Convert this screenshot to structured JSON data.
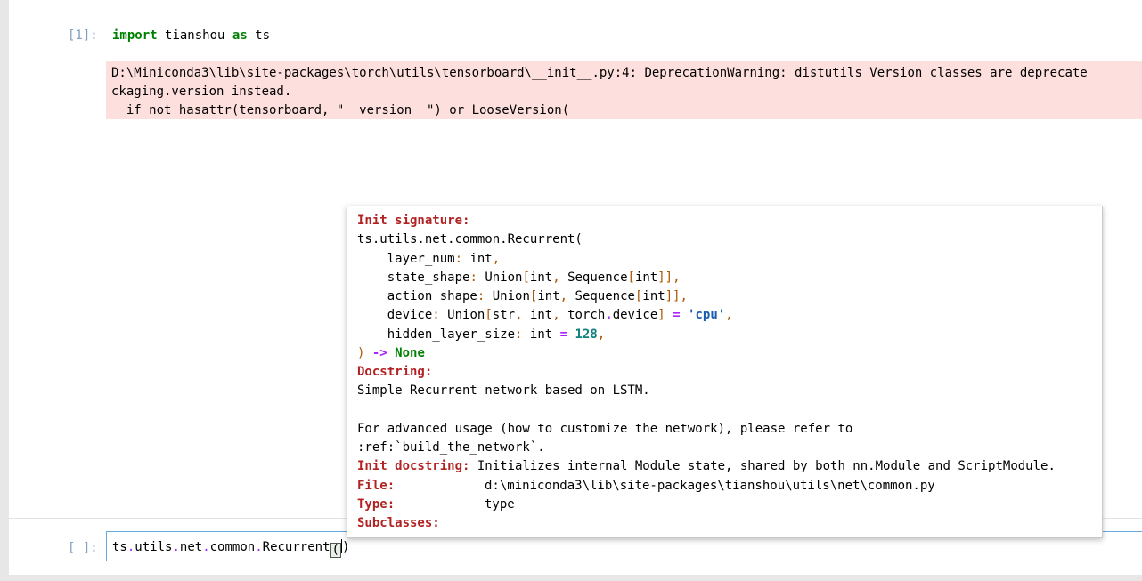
{
  "cell1": {
    "prompt": "[1]:",
    "code": {
      "kw1": "import",
      "mod": "tianshou",
      "kw2": "as",
      "alias": "ts"
    },
    "stderr": [
      "D:\\Miniconda3\\lib\\site-packages\\torch\\utils\\tensorboard\\__init__.py:4: DeprecationWarning: distutils Version classes are deprecate",
      "ckaging.version instead.",
      "  if not hasattr(tensorboard, \"__version__\") or LooseVersion("
    ]
  },
  "cell2": {
    "prompt": "[ ]:",
    "code": {
      "p1": "ts",
      "p2": "utils",
      "p3": "net",
      "p4": "common",
      "p5": "Recurrent",
      "open": "(",
      "close": ")"
    }
  },
  "tooltip": {
    "init_signature_label": "Init signature:",
    "sig_head": "ts.utils.net.common.Recurrent(",
    "params": {
      "layer_num": "layer_num",
      "layer_num_type": "int",
      "state_shape": "state_shape",
      "state_shape_type_a": "Union",
      "state_shape_type_b": "int",
      "state_shape_type_c": "Sequence",
      "state_shape_type_d": "int",
      "action_shape": "action_shape",
      "action_shape_type_a": "Union",
      "action_shape_type_b": "int",
      "action_shape_type_c": "Sequence",
      "action_shape_type_d": "int",
      "device": "device",
      "device_type_a": "Union",
      "device_type_b": "str",
      "device_type_c": "int",
      "device_type_d": "torch",
      "device_type_e": "device",
      "device_default": "'cpu'",
      "hidden": "hidden_layer_size",
      "hidden_type": "int",
      "hidden_default": "128"
    },
    "sig_close": ")",
    "arrow": "->",
    "return_none": "None",
    "docstring_label": "Docstring:",
    "doc_line1": "Simple Recurrent network based on LSTM.",
    "doc_line2": "For advanced usage (how to customize the network), please refer to",
    "doc_line3": ":ref:`build_the_network`.",
    "init_doc_label": "Init docstring:",
    "init_doc_value": "Initializes internal Module state, shared by both nn.Module and ScriptModule.",
    "file_label": "File:",
    "file_value": "d:\\miniconda3\\lib\\site-packages\\tianshou\\utils\\net\\common.py",
    "type_label": "Type:",
    "type_value": "type",
    "subclasses_label": "Subclasses:"
  }
}
